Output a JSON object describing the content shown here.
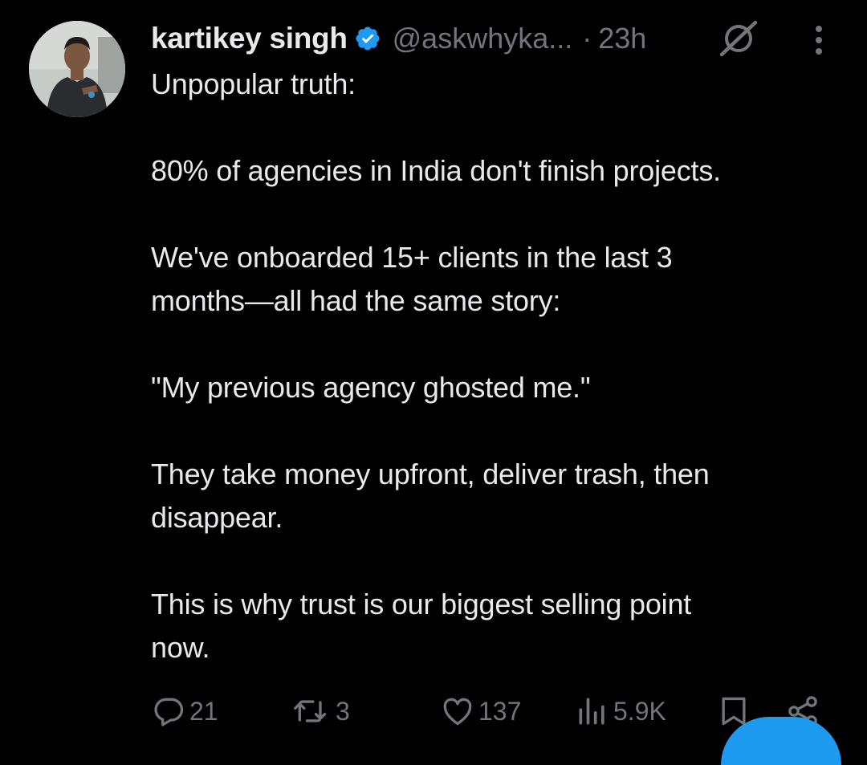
{
  "author": {
    "display_name": "kartikey singh",
    "handle": "@askwhyka...",
    "separator": "·",
    "time": "23h"
  },
  "icons": {
    "verified": "verified-badge-icon",
    "grok": "grok-icon",
    "more": "more-options-icon",
    "reply": "reply-icon",
    "repost": "repost-icon",
    "like": "like-icon",
    "views": "views-icon",
    "bookmark": "bookmark-icon",
    "share": "share-icon"
  },
  "tweet": {
    "paragraphs": [
      "Unpopular truth:",
      "80% of agencies in India don't finish projects.",
      "We've onboarded 15+ clients in the last 3\nmonths—all had the same story:",
      "\"My previous agency ghosted me.\"",
      "They take money upfront, deliver trash, then\ndisappear.",
      "This is why trust is our biggest selling point\nnow."
    ]
  },
  "actions": {
    "replies": "21",
    "reposts": "3",
    "likes": "137",
    "views": "5.9K"
  },
  "colors": {
    "background": "#000000",
    "text": "#e7e9ea",
    "secondary": "#71767b",
    "verified": "#1d9bf0",
    "accent": "#1d9bf0"
  }
}
